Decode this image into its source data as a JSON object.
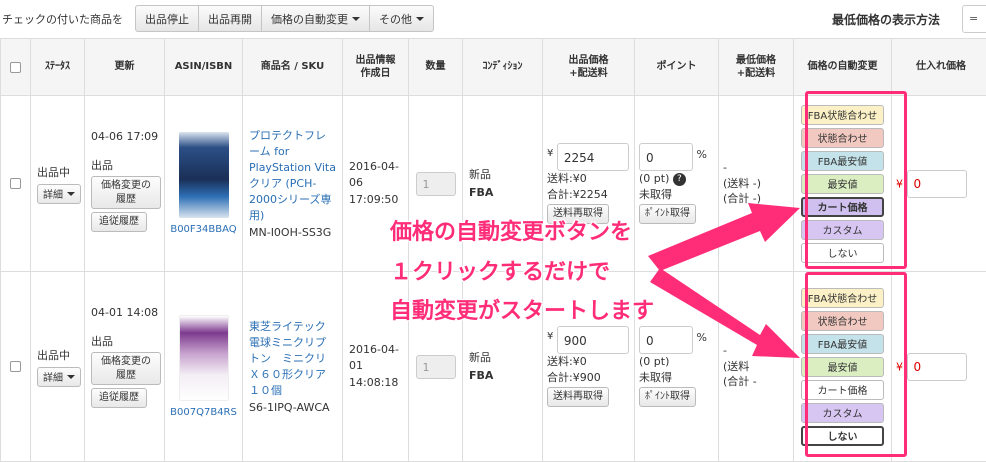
{
  "toolbar": {
    "checked_label": "チェックの付いた商品を",
    "buttons": [
      "出品停止",
      "出品再開",
      "価格の自動変更",
      "その他"
    ],
    "min_price_method_label": "最低価格の表示方法",
    "min_price_method_value": "="
  },
  "table": {
    "headers": {
      "status": "ｽﾃｰﾀｽ",
      "updated": "更新",
      "asin": "ASIN/ISBN",
      "name": "商品名 / SKU",
      "created_l1": "出品情報",
      "created_l2": "作成日",
      "qty": "数量",
      "condition": "ｺﾝﾃﾞｨｼｮﾝ",
      "price_l1": "出品価格",
      "price_l2": "+配送料",
      "point": "ポイント",
      "min_l1": "最低価格",
      "min_l2": "+配送料",
      "auto": "価格の自動変更",
      "purchase": "仕入れ価格"
    },
    "rows": [
      {
        "status": "出品中",
        "detail_btn": "詳細",
        "updated_date": "04-06 17:09",
        "updated_type": "出品",
        "history_btn_l1": "価格変更の",
        "history_btn_l2": "履歴",
        "tracking_btn": "追従履歴",
        "asin": "B00F34BBAQ",
        "name": "プロテクトフレーム for PlayStation Vita クリア (PCH-2000シリーズ専用)",
        "sku": "MN-I0OH-SS3G",
        "created_date": "2016-04-06",
        "created_time": "17:09:50",
        "qty": "1",
        "cond_1": "新品",
        "cond_2": "FBA",
        "price_yen": "¥",
        "price": "2254",
        "shipping": "送料:¥0",
        "total": "合計:¥2254",
        "ship_btn": "送料再取得",
        "point": "0",
        "pct": "%",
        "point_pt": "(0 pt)",
        "point_status": "未取得",
        "point_btn": "ﾎﾟｲﾝﾄ取得",
        "min_price": "-",
        "min_ship": "(送料 -)",
        "min_total": "(合計 -)",
        "auto_options": [
          "FBA状態合わせ",
          "状態合わせ",
          "FBA最安値",
          "最安値",
          "カート価格",
          "カスタム",
          "しない"
        ],
        "auto_selected": "カート価格",
        "purchase_yen": "¥",
        "purchase": "0"
      },
      {
        "status": "出品中",
        "detail_btn": "詳細",
        "updated_date": "04-01 14:08",
        "updated_type": "出品",
        "history_btn_l1": "価格変更の",
        "history_btn_l2": "履歴",
        "tracking_btn": "追従履歴",
        "asin": "B007Q7B4RS",
        "name": "東芝ライテック 電球ミニクリプトン　ミニクリＸ６０形クリア　１０個",
        "sku": "S6-1IPQ-AWCA",
        "created_date": "2016-04-01",
        "created_time": "14:08:18",
        "qty": "1",
        "cond_1": "新品",
        "cond_2": "FBA",
        "price_yen": "¥",
        "price": "900",
        "shipping": "送料:¥0",
        "total": "合計:¥900",
        "ship_btn": "送料再取得",
        "point": "0",
        "pct": "%",
        "point_pt": "(0 pt)",
        "point_status": "未取得",
        "point_btn": "ﾎﾟｲﾝﾄ取得",
        "min_price": "-",
        "min_ship": "(送料",
        "min_total": "(合計 -",
        "auto_options": [
          "FBA状態合わせ",
          "状態合わせ",
          "FBA最安値",
          "最安値",
          "カート価格",
          "カスタム",
          "しない"
        ],
        "auto_selected": "しない",
        "purchase_yen": "¥",
        "purchase": "0"
      }
    ]
  },
  "annotation": {
    "line1": "価格の自動変更ボタンを",
    "line2": "１クリックするだけで",
    "line3": "自動変更がスタートします",
    "color": "#ff2d78"
  }
}
